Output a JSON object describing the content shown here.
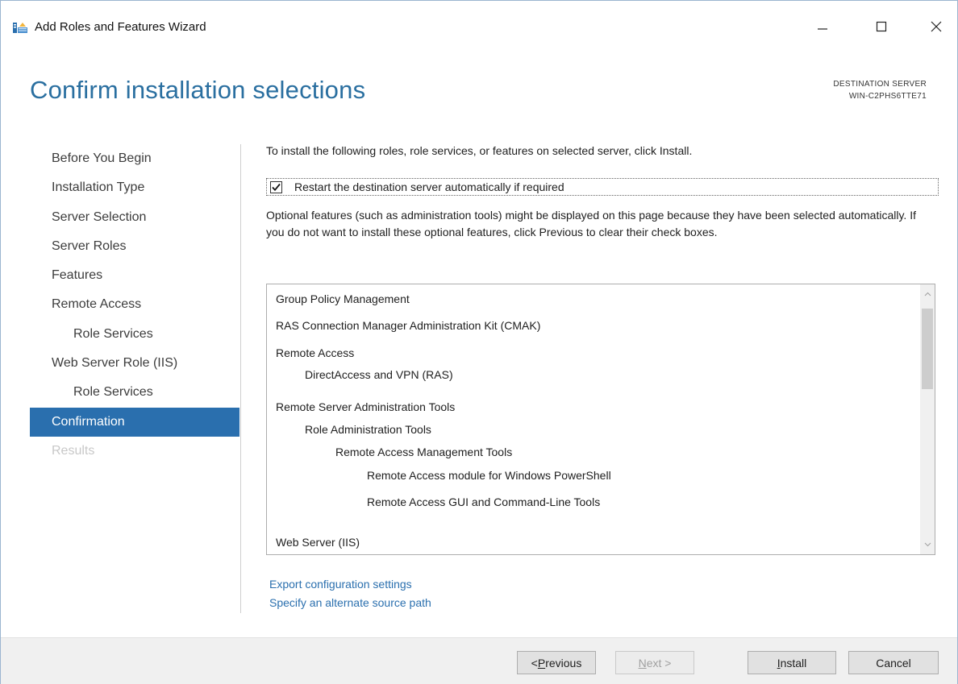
{
  "window": {
    "title": "Add Roles and Features Wizard"
  },
  "header": {
    "page_title": "Confirm installation selections",
    "destination_label": "DESTINATION SERVER",
    "destination_server": "WIN-C2PHS6TTE71"
  },
  "nav": {
    "items": [
      {
        "label": "Before You Begin",
        "state": "normal",
        "indent": false
      },
      {
        "label": "Installation Type",
        "state": "normal",
        "indent": false
      },
      {
        "label": "Server Selection",
        "state": "normal",
        "indent": false
      },
      {
        "label": "Server Roles",
        "state": "normal",
        "indent": false
      },
      {
        "label": "Features",
        "state": "normal",
        "indent": false
      },
      {
        "label": "Remote Access",
        "state": "normal",
        "indent": false
      },
      {
        "label": "Role Services",
        "state": "normal",
        "indent": true
      },
      {
        "label": "Web Server Role (IIS)",
        "state": "normal",
        "indent": false
      },
      {
        "label": "Role Services",
        "state": "normal",
        "indent": true
      },
      {
        "label": "Confirmation",
        "state": "active",
        "indent": false
      },
      {
        "label": "Results",
        "state": "disabled",
        "indent": false
      }
    ]
  },
  "content": {
    "intro": "To install the following roles, role services, or features on selected server, click Install.",
    "restart_checked": true,
    "restart_label": "Restart the destination server automatically if required",
    "optional_text": "Optional features (such as administration tools) might be displayed on this page because they have been selected automatically. If you do not want to install these optional features, click Previous to clear their check boxes.",
    "selections": [
      {
        "label": "Group Policy Management",
        "level": 0
      },
      {
        "label": "RAS Connection Manager Administration Kit (CMAK)",
        "level": 0
      },
      {
        "label": "Remote Access",
        "level": 0
      },
      {
        "label": "DirectAccess and VPN (RAS)",
        "level": 1
      },
      {
        "label": "Remote Server Administration Tools",
        "level": 0
      },
      {
        "label": "Role Administration Tools",
        "level": 1
      },
      {
        "label": "Remote Access Management Tools",
        "level": 2
      },
      {
        "label": "Remote Access module for Windows PowerShell",
        "level": 3
      },
      {
        "label": "Remote Access GUI and Command-Line Tools",
        "level": 3
      },
      {
        "label": "Web Server (IIS)",
        "level": 0
      }
    ],
    "export_link": "Export configuration settings",
    "alt_source_link": "Specify an alternate source path"
  },
  "footer": {
    "previous": {
      "prefix": "< ",
      "accel": "P",
      "rest": "revious"
    },
    "next": {
      "accel": "N",
      "rest": "ext >"
    },
    "install": {
      "accel": "I",
      "rest": "nstall"
    },
    "cancel": "Cancel"
  },
  "colors": {
    "accent": "#2a6fae",
    "title": "#2a6fa0",
    "disabled": "#c8c8c8"
  }
}
